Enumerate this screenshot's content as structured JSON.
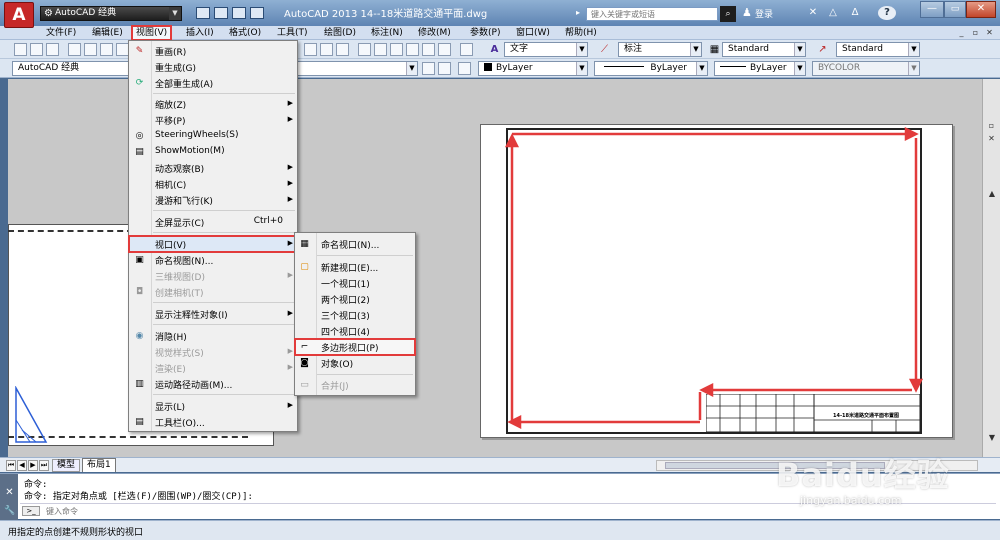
{
  "title_bar": {
    "app_logo": "A",
    "workspace": "AutoCAD 经典",
    "window_title": "AutoCAD 2013    14--18米道路交通平面.dwg",
    "search_placeholder": "键入关键字或短语",
    "login_label": "登录",
    "help_icon_label": "?"
  },
  "menubar": {
    "items": [
      "文件(F)",
      "编辑(E)",
      "视图(V)",
      "插入(I)",
      "格式(O)",
      "工具(T)",
      "绘图(D)",
      "标注(N)",
      "修改(M)",
      "参数(P)",
      "窗口(W)",
      "帮助(H)"
    ]
  },
  "toolbar1": {
    "text_style": "文字",
    "dim_style": "标注",
    "table_style": "Standard",
    "multileader_style": "Standard"
  },
  "toolbar2": {
    "workspace": "AutoCAD 经典",
    "color": "ByLayer",
    "linetype": "ByLayer",
    "lineweight": "ByLayer",
    "plot_style": "BYCOLOR"
  },
  "view_menu": {
    "items": [
      {
        "label": "重画(R)"
      },
      {
        "label": "重生成(G)"
      },
      {
        "label": "全部重生成(A)"
      },
      {
        "label": "缩放(Z)"
      },
      {
        "label": "平移(P)"
      },
      {
        "label": "SteeringWheels(S)"
      },
      {
        "label": "ShowMotion(M)"
      },
      {
        "label": "动态观察(B)"
      },
      {
        "label": "相机(C)"
      },
      {
        "label": "漫游和飞行(K)"
      },
      {
        "label": "全屏显示(C)",
        "shortcut": "Ctrl+0"
      },
      {
        "label": "视口(V)"
      },
      {
        "label": "命名视图(N)..."
      },
      {
        "label": "三维视图(D)"
      },
      {
        "label": "创建相机(T)"
      },
      {
        "label": "显示注释性对象(I)"
      },
      {
        "label": "消隐(H)"
      },
      {
        "label": "视觉样式(S)"
      },
      {
        "label": "渲染(E)"
      },
      {
        "label": "运动路径动画(M)..."
      },
      {
        "label": "显示(L)"
      },
      {
        "label": "工具栏(O)..."
      }
    ]
  },
  "viewport_submenu": {
    "items": [
      {
        "label": "命名视口(N)..."
      },
      {
        "label": "新建视口(E)..."
      },
      {
        "label": "一个视口(1)"
      },
      {
        "label": "两个视口(2)"
      },
      {
        "label": "三个视口(3)"
      },
      {
        "label": "四个视口(4)"
      },
      {
        "label": "多边形视口(P)"
      },
      {
        "label": "对象(O)"
      },
      {
        "label": "合并(J)"
      }
    ]
  },
  "drawing": {
    "title_block_text": "14-18米道路交通平面布置图"
  },
  "layout_tabs": {
    "model": "模型",
    "layout1": "布局1"
  },
  "command_window": {
    "history": [
      "命令:",
      "命令: 指定对角点或 [栏选(F)/圈围(WP)/圈交(CP)]:"
    ],
    "input_placeholder": "键入命令"
  },
  "status_bar": {
    "text": "用指定的点创建不规则形状的视口"
  },
  "watermark": {
    "brand": "Baidu经验",
    "url": "jingyan.baidu.com"
  },
  "colors": {
    "highlight_red": "#e23b3b",
    "title_bar_blue": "#6f93c0",
    "menu_bg": "#f0f0f0"
  }
}
